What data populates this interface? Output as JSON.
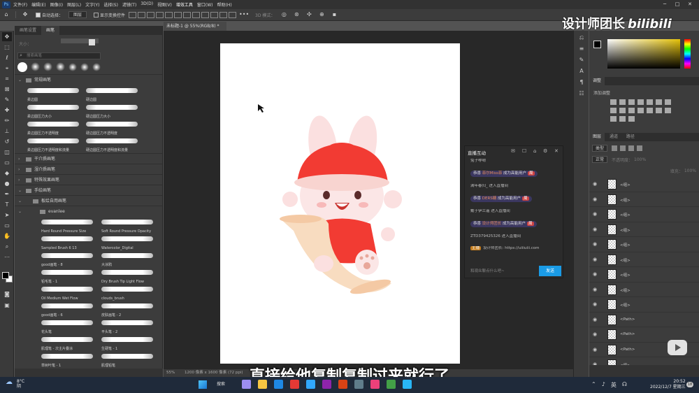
{
  "menubar": {
    "items": [
      "文件(F)",
      "编辑(E)",
      "图像(I)",
      "图层(L)",
      "文字(Y)",
      "选择(S)",
      "滤镜(T)",
      "3D(D)",
      "视图(V)",
      "增效工具",
      "窗口(W)",
      "帮助(H)"
    ],
    "active_index": 9
  },
  "options": {
    "auto_select": "自动选择：",
    "layer_select": "图层",
    "show_transform": "显示变换控件",
    "mode_3d": "3D 模式："
  },
  "brush_panel": {
    "tabs": [
      "画笔设置",
      "画笔"
    ],
    "size_label": "大小：",
    "search_placeholder": "搜索画笔",
    "groups": [
      "常规画笔",
      "干介质画笔",
      "湿介质画笔",
      "特殊效果画笔",
      "手绘画笔",
      "板绘自用画笔"
    ],
    "brushes_top": [
      "柔边圆",
      "硬边圆",
      "柔边圆压力大小",
      "硬边圆压力大小",
      "柔边圆压力不透明度",
      "硬边圆压力不透明度",
      "柔边圆压力不透明度和流量",
      "硬边圆压力不透明度和流量"
    ],
    "subfolder": "evanlee",
    "brushes_sub": [
      "Hard Round Pressure Size",
      "Soft Round Pressure Opacity",
      "Sampled Brush 6 13",
      "Watercolor_Digital",
      "good画笔 - 8",
      "大涂鸦",
      "铅毛笔 - 1",
      "Dry Brush Tip Light Flow",
      "Oil Medium Wet Flow",
      "clouds_brush",
      "good画笔 - 6",
      "皮肤画笔 - 2",
      "花头笔",
      "平头笔 - 2",
      "肌理笔 - 次主片叠涂",
      "生硬笔 - 1",
      "草树叶笔 - 1",
      "肌理铅笔"
    ]
  },
  "document": {
    "tab_title": "未标题-1 @ 55%(RGB/8) *",
    "zoom": "55%",
    "size_info": "1200 像素 x 1600 像素 (72 ppi)"
  },
  "live_panel": {
    "title": "直播互动",
    "messages": [
      {
        "type": "text",
        "text": "兔子咿呦"
      },
      {
        "type": "pill",
        "prefix": "恭喜",
        "name": "菲尔Miss菲",
        "action": "成为高能用户",
        "tag": "周"
      },
      {
        "type": "text",
        "text": "满年春归_ 进入直播间"
      },
      {
        "type": "pill",
        "prefix": "恭喜",
        "name": "DERS糖",
        "action": "成为高能用户",
        "tag": "周"
      },
      {
        "type": "text",
        "text": "戴于伊兰遥 进入直播间"
      },
      {
        "type": "pill",
        "prefix": "恭喜",
        "name": "设计师团长",
        "action": "成为高能用户",
        "tag": "周"
      },
      {
        "type": "text",
        "text": "ZTD379425326 进入直播间"
      },
      {
        "type": "badge",
        "badge": "主播",
        "text": "设计师团长: https://uiiiuiii.com"
      }
    ],
    "input_placeholder": "和观众聊点什么吧~",
    "send_label": "发送"
  },
  "right_panel": {
    "panel_tabs": [
      "调整"
    ],
    "adj_label": "添加调整",
    "layer_tabs": [
      "图层",
      "通道",
      "路径"
    ],
    "layer_kind": "类型",
    "blend_mode": "正常",
    "opacity_label": "不透明度：",
    "opacity": "100%",
    "fill_label": "填充：",
    "fill": "100%",
    "layers": [
      "<组>",
      "<组>",
      "<组>",
      "<组>",
      "<组>",
      "<组>",
      "<组>",
      "<组>",
      "<组>",
      "<Path>",
      "<Path>",
      "<Path>",
      "<组>"
    ]
  },
  "overlay": {
    "watermark": "设计师团长",
    "brand": "bilibili",
    "subtitle": "直接给他复制复制过来就行了"
  },
  "taskbar": {
    "weather_temp": "8°C",
    "weather_desc": "阴",
    "search": "搜索",
    "ime": "英",
    "time": "20:52",
    "date": "2022/12/7 星期三",
    "notify_count": "18"
  }
}
